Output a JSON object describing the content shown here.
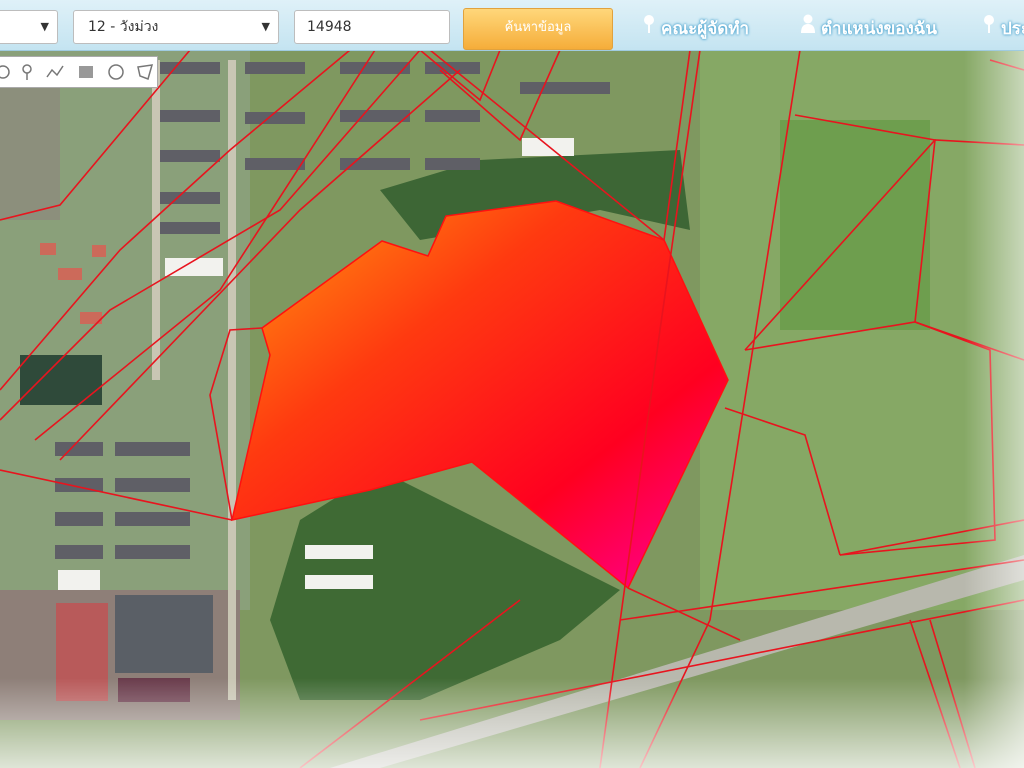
{
  "topbar": {
    "province_select": {
      "value": ""
    },
    "subdistrict_select": {
      "value": "12 - วังม่วง"
    },
    "parcel_input": {
      "value": "14948",
      "placeholder": ""
    },
    "search_button": {
      "label": "ค้นหาข้อมูล"
    },
    "nav": [
      {
        "icon": "pin-icon",
        "label": "คณะผู้จัดทำ"
      },
      {
        "icon": "person-icon",
        "label": "ตำแหน่งของฉัน"
      },
      {
        "icon": "pin-icon",
        "label": "ประ"
      }
    ]
  },
  "draw_tools": [
    {
      "name": "draw-pin-tool",
      "icon": "marker-icon"
    },
    {
      "name": "draw-line-tool",
      "icon": "polyline-icon"
    },
    {
      "name": "draw-rectangle-tool",
      "icon": "rectangle-icon"
    },
    {
      "name": "draw-circle-tool",
      "icon": "circle-icon"
    },
    {
      "name": "draw-polygon-tool",
      "icon": "polygon-icon"
    }
  ],
  "highlight": {
    "gradient": [
      "#ffa010",
      "#ff3a10",
      "#ff0020",
      "#ff00a0"
    ]
  }
}
